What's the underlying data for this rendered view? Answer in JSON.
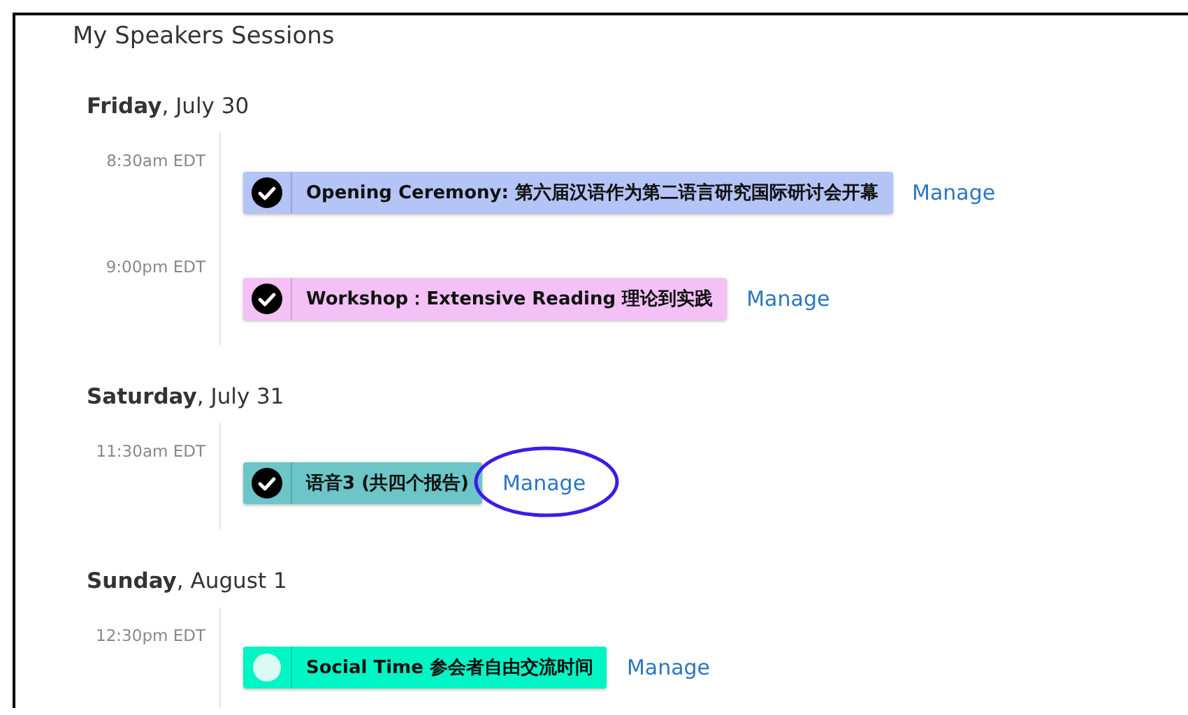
{
  "title": "My Speakers Sessions",
  "days": [
    {
      "heading": "**Friday**, July 30",
      "sessions": [
        {
          "time": "8:30am EDT",
          "name": "Opening Ceremony: 第六届汉语作为第二语言研究国际研讨会开幕",
          "color": "#b4c4f6",
          "checked": true,
          "action": "Manage",
          "circled": false
        },
        {
          "time": "9:00pm EDT",
          "name": "Workshop：Extensive Reading 理论到实践",
          "color": "#f3c1f6",
          "checked": true,
          "action": "Manage",
          "circled": false
        }
      ]
    },
    {
      "heading": "**Saturday**, July 31",
      "sessions": [
        {
          "time": "11:30am EDT",
          "name": "语音3 (共四个报告)",
          "color": "#6cc6c8",
          "checked": true,
          "action": "Manage",
          "circled": true
        }
      ]
    },
    {
      "heading": "**Sunday**, August 1",
      "sessions": [
        {
          "time": "12:30pm EDT",
          "name": "Social Time 参会者自由交流时间",
          "color": "#00f5c5",
          "checked": false,
          "action": "Manage",
          "circled": false
        }
      ]
    }
  ]
}
